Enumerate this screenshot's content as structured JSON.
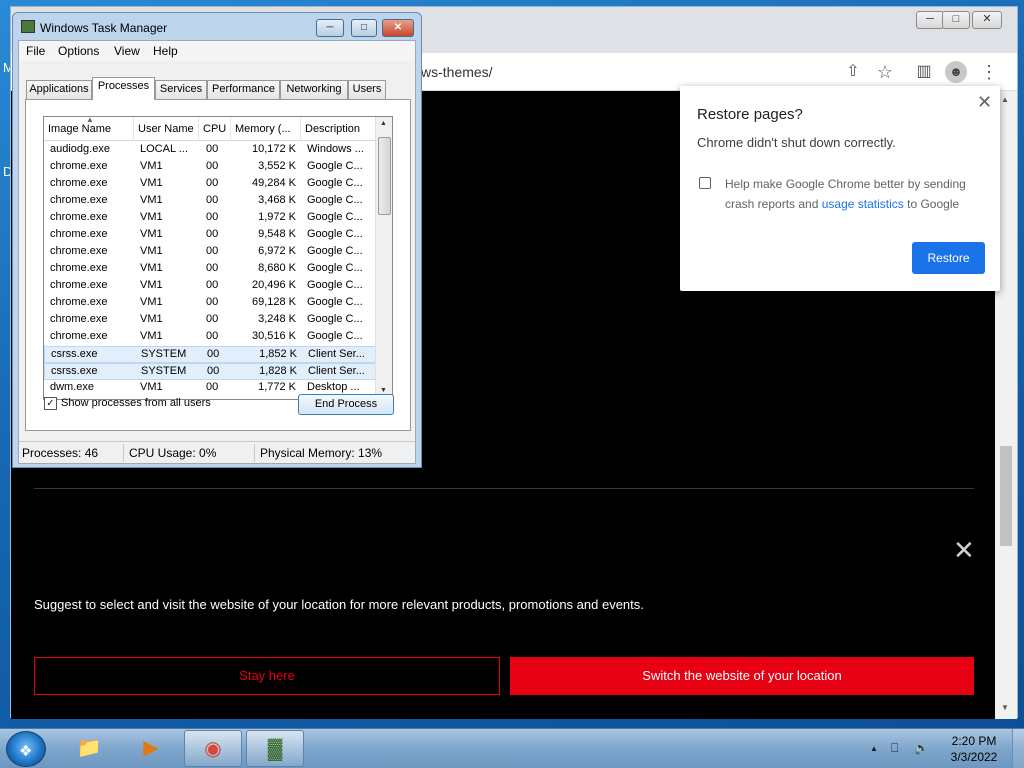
{
  "desktop": {
    "letter_m": "M",
    "letter_d": "D"
  },
  "chrome": {
    "url_partial": "ws-themes/",
    "min_label": "─",
    "max_label": "□",
    "close_label": "✕",
    "toolbar_icons": [
      "share-icon",
      "star-icon",
      "side-panel-icon",
      "profile-icon",
      "menu-icon"
    ],
    "star_glyph": "☆",
    "share_glyph": "⇧",
    "panel_glyph": "▥",
    "profile_glyph": "☻",
    "menu_glyph": "⋮",
    "page": {
      "close_glyph": "✕",
      "suggest_text": "Suggest to select and visit the website of your location for more relevant products, promotions and events.",
      "stay_button": "Stay here",
      "switch_button": "Switch the website of your location",
      "accent_color": "#e60012"
    },
    "restore_popup": {
      "title": "Restore pages?",
      "subtitle": "Chrome didn't shut down correctly.",
      "checkbox_text": "Help make Google Chrome better by sending crash reports and",
      "link_text": "usage statistics",
      "checkbox_suffix": "to Google",
      "restore_button": "Restore",
      "close_glyph": "✕"
    }
  },
  "task_manager": {
    "title": "Windows Task Manager",
    "menus": [
      "File",
      "Options",
      "View",
      "Help"
    ],
    "tabs": [
      "Applications",
      "Processes",
      "Services",
      "Performance",
      "Networking",
      "Users"
    ],
    "active_tab": "Processes",
    "columns": [
      "Image Name",
      "User Name",
      "CPU",
      "Memory (...",
      "Description"
    ],
    "rows": [
      [
        "audiodg.exe",
        "LOCAL ...",
        "00",
        "10,172 K",
        "Windows ..."
      ],
      [
        "chrome.exe",
        "VM1",
        "00",
        "3,552 K",
        "Google C..."
      ],
      [
        "chrome.exe",
        "VM1",
        "00",
        "49,284 K",
        "Google C..."
      ],
      [
        "chrome.exe",
        "VM1",
        "00",
        "3,468 K",
        "Google C..."
      ],
      [
        "chrome.exe",
        "VM1",
        "00",
        "1,972 K",
        "Google C..."
      ],
      [
        "chrome.exe",
        "VM1",
        "00",
        "9,548 K",
        "Google C..."
      ],
      [
        "chrome.exe",
        "VM1",
        "00",
        "6,972 K",
        "Google C..."
      ],
      [
        "chrome.exe",
        "VM1",
        "00",
        "8,680 K",
        "Google C..."
      ],
      [
        "chrome.exe",
        "VM1",
        "00",
        "20,496 K",
        "Google C..."
      ],
      [
        "chrome.exe",
        "VM1",
        "00",
        "69,128 K",
        "Google C..."
      ],
      [
        "chrome.exe",
        "VM1",
        "00",
        "3,248 K",
        "Google C..."
      ],
      [
        "chrome.exe",
        "VM1",
        "00",
        "30,516 K",
        "Google C..."
      ],
      [
        "csrss.exe",
        "SYSTEM",
        "00",
        "1,852 K",
        "Client Ser..."
      ],
      [
        "csrss.exe",
        "SYSTEM",
        "00",
        "1,828 K",
        "Client Ser..."
      ],
      [
        "dwm.exe",
        "VM1",
        "00",
        "1,772 K",
        "Desktop ..."
      ]
    ],
    "highlighted_rows": [
      12,
      13
    ],
    "show_all_label": "Show processes from all users",
    "show_all_checked": "✓",
    "end_process_label": "End Process",
    "status": {
      "processes": "Processes: 46",
      "cpu": "CPU Usage: 0%",
      "memory": "Physical Memory: 13%"
    }
  },
  "taskbar": {
    "apps": [
      "explorer-icon",
      "media-player-icon",
      "chrome-icon",
      "task-manager-icon"
    ],
    "explorer_glyph": "📁",
    "media_glyph": "▶",
    "chrome_glyph": "◉",
    "taskmgr_glyph": "▓",
    "tray_up": "▲",
    "tray_network": "⎕",
    "tray_volume": "🔈",
    "time": "2:20 PM",
    "date": "3/3/2022"
  }
}
